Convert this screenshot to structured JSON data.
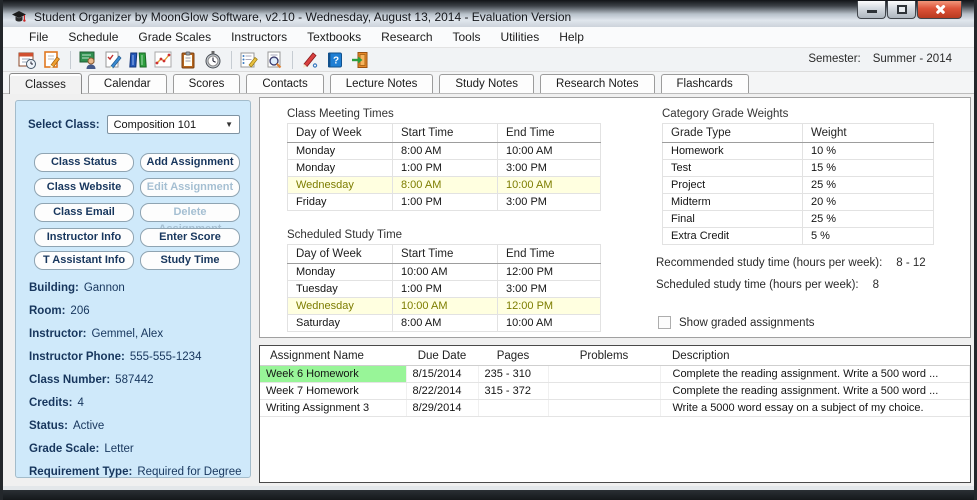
{
  "window": {
    "title": "Student Organizer by MoonGlow Software, v2.10  -  Wednesday, August 13, 2014  -  Evaluation Version"
  },
  "menu": {
    "items": [
      "File",
      "Schedule",
      "Grade Scales",
      "Instructors",
      "Textbooks",
      "Research",
      "Tools",
      "Utilities",
      "Help"
    ]
  },
  "toolbar": {
    "icons": [
      "schedule",
      "add-assignment",
      "instructors",
      "grade-scales",
      "textbooks",
      "scores",
      "notes",
      "study-timer",
      "flashcards",
      "research",
      "tools",
      "help",
      "exit"
    ]
  },
  "semester": {
    "label": "Semester:",
    "value": "Summer - 2014"
  },
  "tabs": {
    "items": [
      {
        "label": "Classes",
        "active": true
      },
      {
        "label": "Calendar",
        "active": false
      },
      {
        "label": "Scores",
        "active": false
      },
      {
        "label": "Contacts",
        "active": false
      },
      {
        "label": "Lecture Notes",
        "active": false
      },
      {
        "label": "Study Notes",
        "active": false
      },
      {
        "label": "Research Notes",
        "active": false
      },
      {
        "label": "Flashcards",
        "active": false
      }
    ]
  },
  "sidebar": {
    "select_class_label": "Select Class:",
    "select_class_value": "Composition 101",
    "buttons": [
      {
        "label": "Class Status",
        "enabled": true
      },
      {
        "label": "Add Assignment",
        "enabled": true
      },
      {
        "label": "Class Website",
        "enabled": true
      },
      {
        "label": "Edit Assignment",
        "enabled": false
      },
      {
        "label": "Class Email",
        "enabled": true
      },
      {
        "label": "Delete Assignment",
        "enabled": false
      },
      {
        "label": "Instructor Info",
        "enabled": true
      },
      {
        "label": "Enter Score",
        "enabled": true
      },
      {
        "label": "T Assistant Info",
        "enabled": true
      },
      {
        "label": "Study Time",
        "enabled": true
      }
    ],
    "info": [
      {
        "label": "Building:",
        "value": "Gannon"
      },
      {
        "label": "Room:",
        "value": "206"
      },
      {
        "label": "Instructor:",
        "value": "Gemmel, Alex"
      },
      {
        "label": "Instructor Phone:",
        "value": "555-555-1234"
      },
      {
        "label": "Class Number:",
        "value": "587442"
      },
      {
        "label": "Credits:",
        "value": "4"
      },
      {
        "label": "Status:",
        "value": "Active"
      },
      {
        "label": "Grade Scale:",
        "value": "Letter"
      },
      {
        "label": "Requirement Type:",
        "value": "Required for Degree"
      }
    ]
  },
  "meeting_times": {
    "title": "Class Meeting Times",
    "headers": [
      "Day of Week",
      "Start Time",
      "End Time"
    ],
    "rows": [
      {
        "day": "Monday",
        "start": "8:00 AM",
        "end": "10:00 AM",
        "highlight": false
      },
      {
        "day": "Monday",
        "start": "1:00 PM",
        "end": "3:00 PM",
        "highlight": false
      },
      {
        "day": "Wednesday",
        "start": "8:00 AM",
        "end": "10:00 AM",
        "highlight": true
      },
      {
        "day": "Friday",
        "start": "1:00 PM",
        "end": "3:00 PM",
        "highlight": false
      }
    ]
  },
  "study_time": {
    "title": "Scheduled Study Time",
    "headers": [
      "Day of Week",
      "Start Time",
      "End Time"
    ],
    "rows": [
      {
        "day": "Monday",
        "start": "10:00 AM",
        "end": "12:00 PM",
        "highlight": false
      },
      {
        "day": "Tuesday",
        "start": "1:00 PM",
        "end": "3:00 PM",
        "highlight": false
      },
      {
        "day": "Wednesday",
        "start": "10:00 AM",
        "end": "12:00 PM",
        "highlight": true
      },
      {
        "day": "Saturday",
        "start": "8:00 AM",
        "end": "10:00 AM",
        "highlight": false
      }
    ]
  },
  "grade_weights": {
    "title": "Category Grade Weights",
    "headers": [
      "Grade Type",
      "Weight"
    ],
    "rows": [
      {
        "type": "Homework",
        "weight": "10 %"
      },
      {
        "type": "Test",
        "weight": "15 %"
      },
      {
        "type": "Project",
        "weight": "25 %"
      },
      {
        "type": "Midterm",
        "weight": "20 %"
      },
      {
        "type": "Final",
        "weight": "25 %"
      },
      {
        "type": "Extra Credit",
        "weight": "5 %"
      }
    ]
  },
  "study_info": {
    "recommended_label": "Recommended study time (hours per week):",
    "recommended_value": "8 - 12",
    "scheduled_label": "Scheduled study time (hours per week):",
    "scheduled_value": "8",
    "checkbox_label": "Show graded assignments",
    "checkbox_checked": false
  },
  "assignments": {
    "headers": [
      "Assignment Name",
      "Due Date",
      "Pages",
      "Problems",
      "Description"
    ],
    "rows": [
      {
        "name": "Week 6 Homework",
        "due": "8/15/2014",
        "pages": "235 - 310",
        "problems": "",
        "description": "Complete the reading assignment. Write a 500 word ...",
        "name_highlight": "green",
        "due_overdue": true
      },
      {
        "name": "Week 7 Homework",
        "due": "8/22/2014",
        "pages": "315 - 372",
        "problems": "",
        "description": "Complete the reading assignment. Write a 500 word ...",
        "name_highlight": "olive",
        "due_overdue": false
      },
      {
        "name": "Writing Assignment 3",
        "due": "8/29/2014",
        "pages": "",
        "problems": "",
        "description": "Write a 5000 word essay on a subject of my choice.",
        "name_highlight": "maroon",
        "due_overdue": false
      }
    ]
  },
  "colors": {
    "sidebar_bg": "#cfe9fa",
    "navy_text": "#17365d",
    "highlight_row_bg": "#ffffe0",
    "highlight_row_text": "#7d7d00",
    "assignment_green_bg": "#98f598",
    "due_date_red": "#dd3333",
    "assignment_maroon": "#8b4540",
    "close_button_red": "#c23a22"
  }
}
